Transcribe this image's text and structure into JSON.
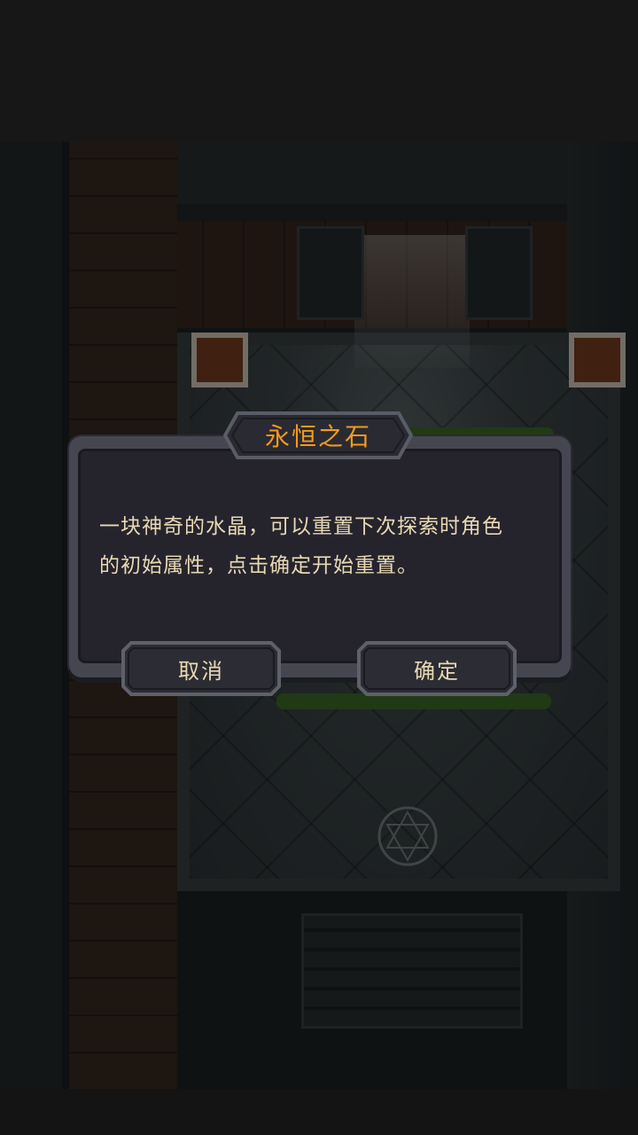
{
  "dialog": {
    "title": "永恒之石",
    "message_line1": "一块神奇的水晶，可以重置下次探索时角色",
    "message_line2": "的初始属性，点击确定开始重置。",
    "cancel_label": "取消",
    "confirm_label": "确定"
  },
  "colors": {
    "title_text": "#f39a1e",
    "body_text": "#e8d9b4",
    "dialog_panel": "#25242d",
    "dialog_frame": "#45464f"
  }
}
